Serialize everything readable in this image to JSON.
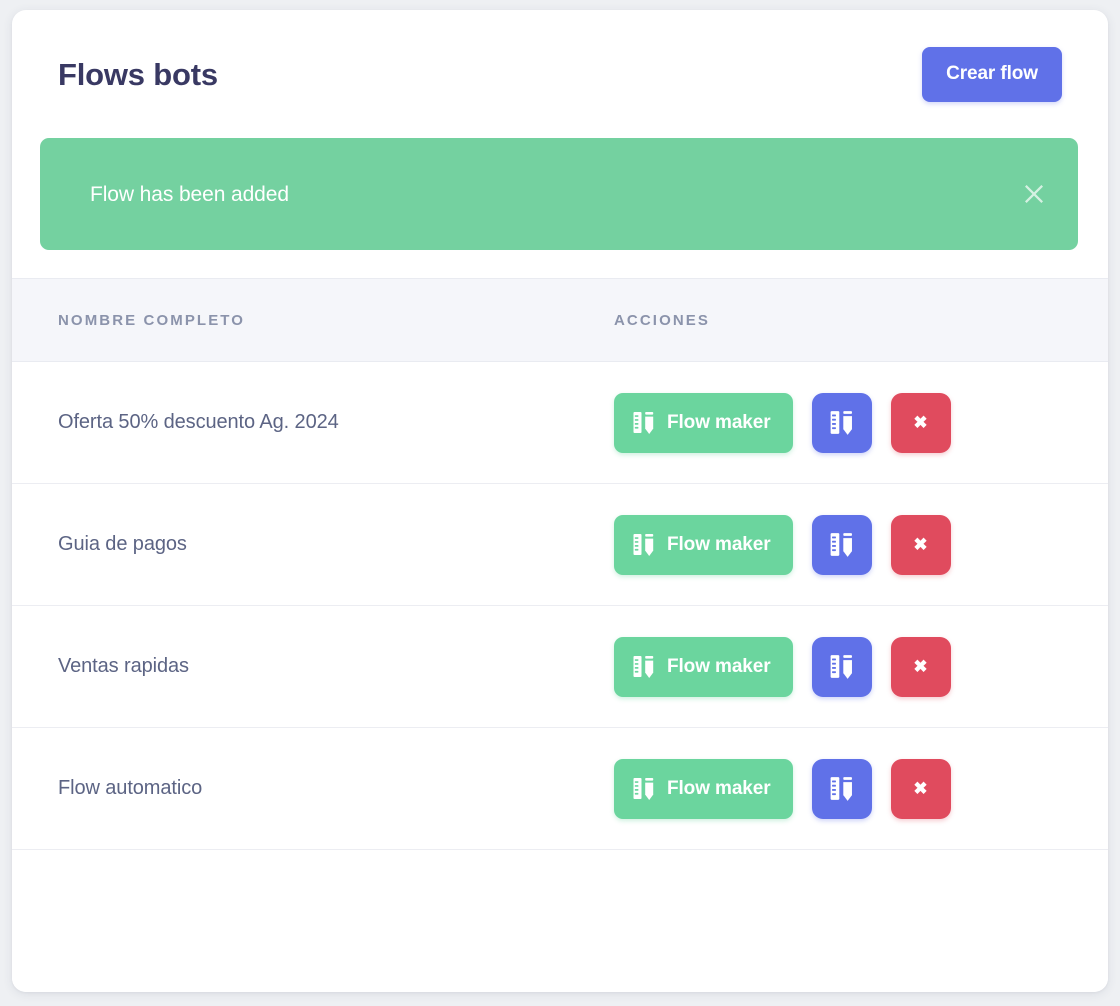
{
  "header": {
    "title": "Flows bots",
    "create_button": "Crear flow"
  },
  "alert": {
    "message": "Flow has been added",
    "type": "success",
    "color": "#74d1a0",
    "close_icon": "close-icon"
  },
  "table": {
    "columns": [
      "NOMBRE COMPLETO",
      "ACCIONES"
    ],
    "rows": [
      {
        "name": "Oferta 50% descuento Ag. 2024"
      },
      {
        "name": "Guia de pagos"
      },
      {
        "name": "Ventas rapidas"
      },
      {
        "name": "Flow automatico"
      }
    ]
  },
  "actions": {
    "maker_label": "Flow maker",
    "maker_icon": "ruler-pen-icon",
    "edit_icon": "ruler-pen-icon",
    "delete_icon": "close-icon",
    "delete_glyph": "✖"
  },
  "colors": {
    "page_background": "#eef0f3",
    "card_background": "#ffffff",
    "title": "#393963",
    "primary": "#6071e8",
    "success": "#6bd59e",
    "danger": "#e04b5e",
    "table_header_background": "#f5f6fa",
    "table_header_text": "#8b93ab",
    "row_text": "#5c6484"
  }
}
